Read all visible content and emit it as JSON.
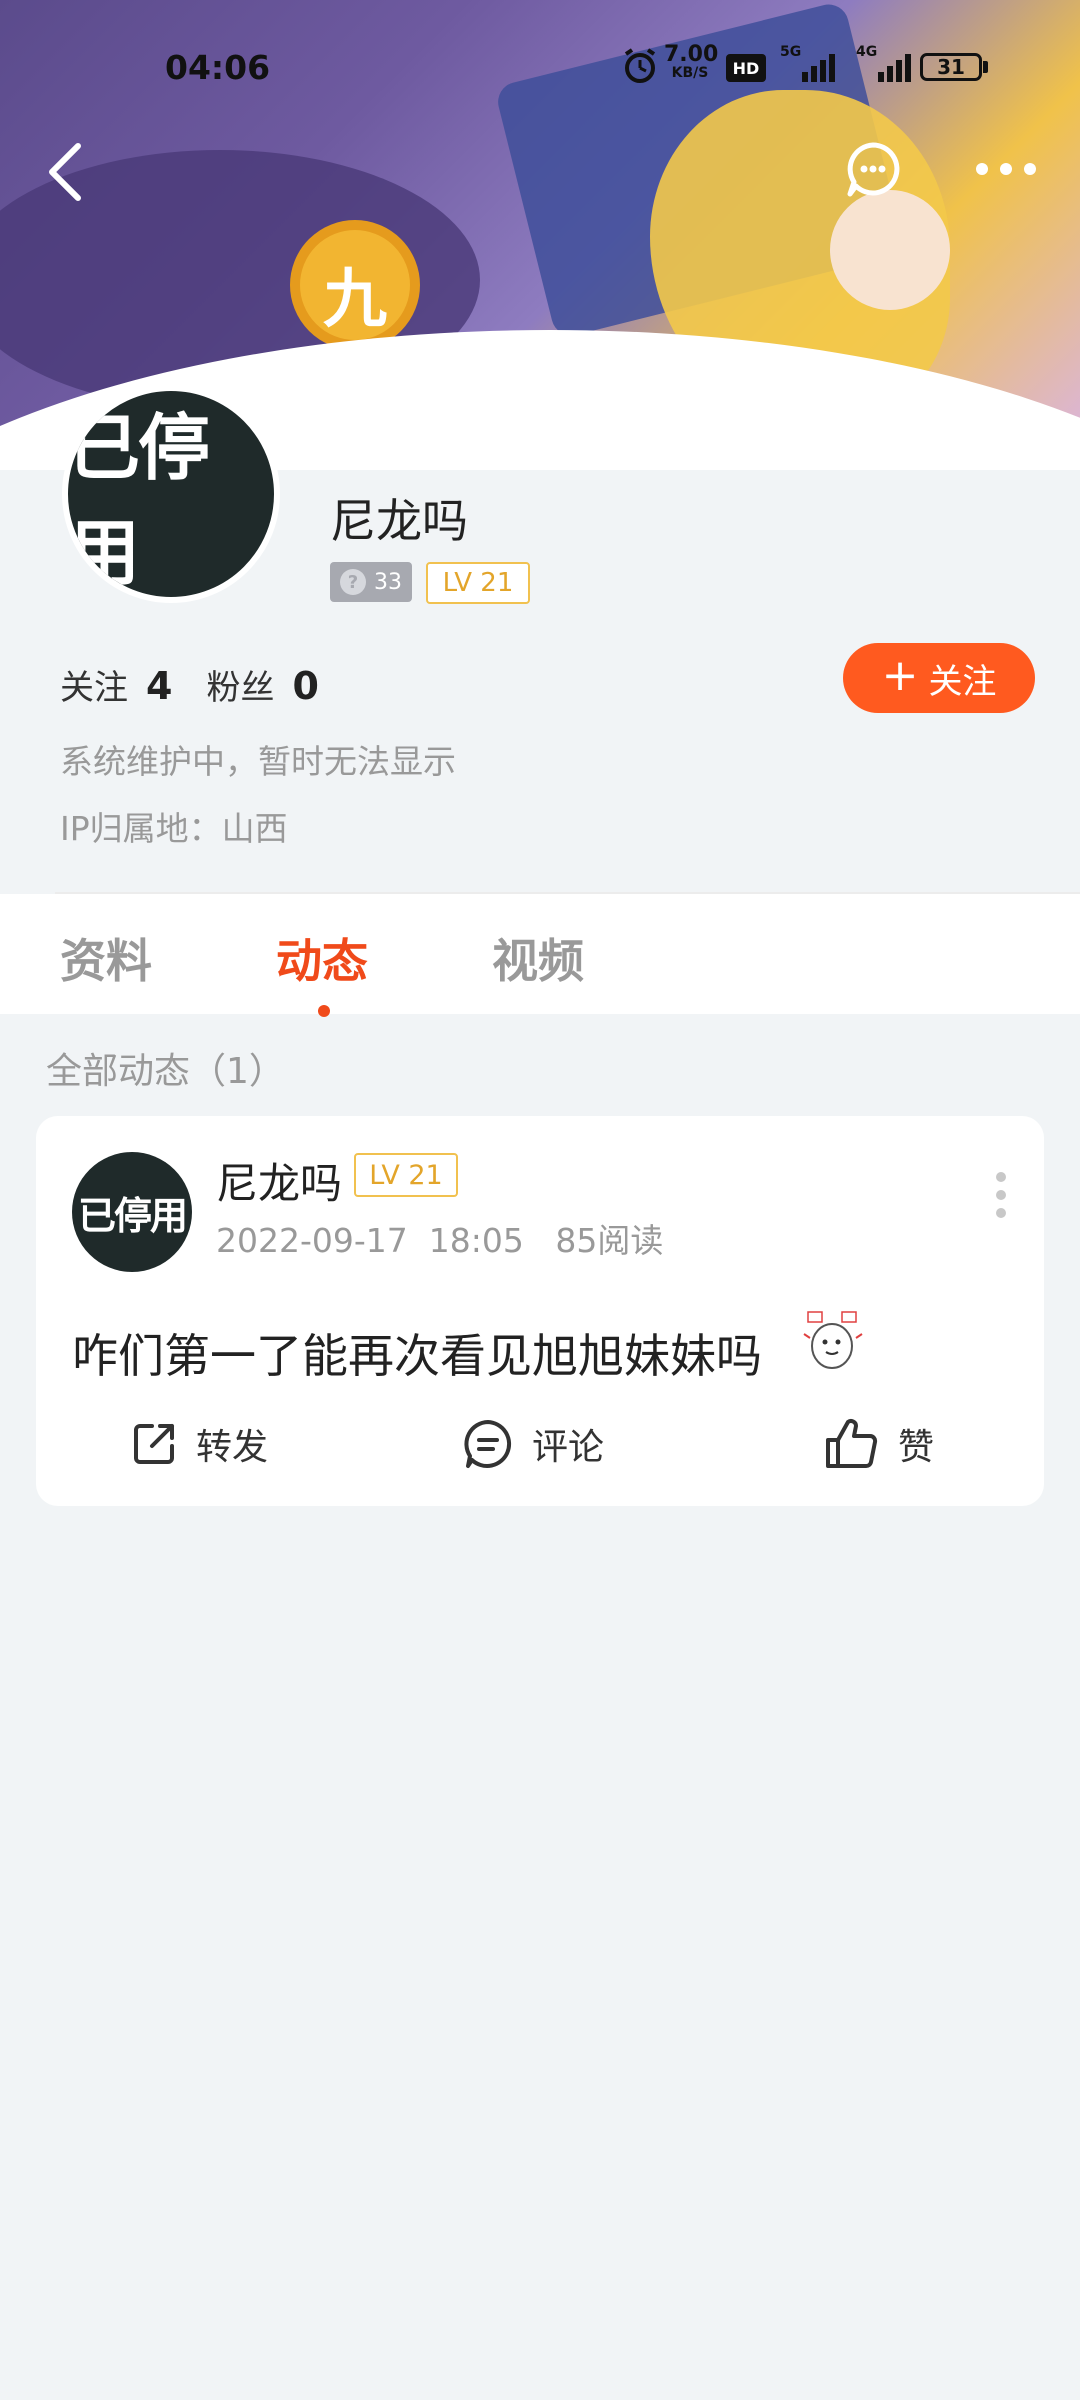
{
  "status_bar": {
    "time": "04:06",
    "net_speed": "7.00",
    "net_unit": "KB/S",
    "hd_label": "HD",
    "sim1": "5G",
    "sim2": "4G",
    "battery": "31"
  },
  "profile": {
    "avatar_text": "已停用",
    "username": "尼龙吗",
    "badge_count": "33",
    "level": "LV 21",
    "following_label": "关注",
    "following_count": "4",
    "followers_label": "粉丝",
    "followers_count": "0",
    "follow_button": "关注",
    "bio": "系统维护中，暂时无法显示",
    "ip_location": "IP归属地：山西"
  },
  "tabs": [
    "资料",
    "动态",
    "视频"
  ],
  "active_tab_index": 1,
  "feed": {
    "section_title": "全部动态（1）",
    "posts": [
      {
        "avatar_text": "已停用",
        "username": "尼龙吗",
        "level": "LV 21",
        "date": "2022-09-17",
        "time": "18:05",
        "reads": "85阅读",
        "content": "咋们第一了能再次看见旭旭妹妹吗",
        "actions": {
          "share": "转发",
          "comment": "评论",
          "like": "赞"
        }
      }
    ]
  },
  "colors": {
    "accent": "#ff5a1f",
    "tab_active": "#f04a1a",
    "level_badge": "#e3a52a"
  },
  "icons": {
    "back": "back-arrow-icon",
    "message": "message-bubble-icon",
    "more": "more-dots-icon"
  }
}
